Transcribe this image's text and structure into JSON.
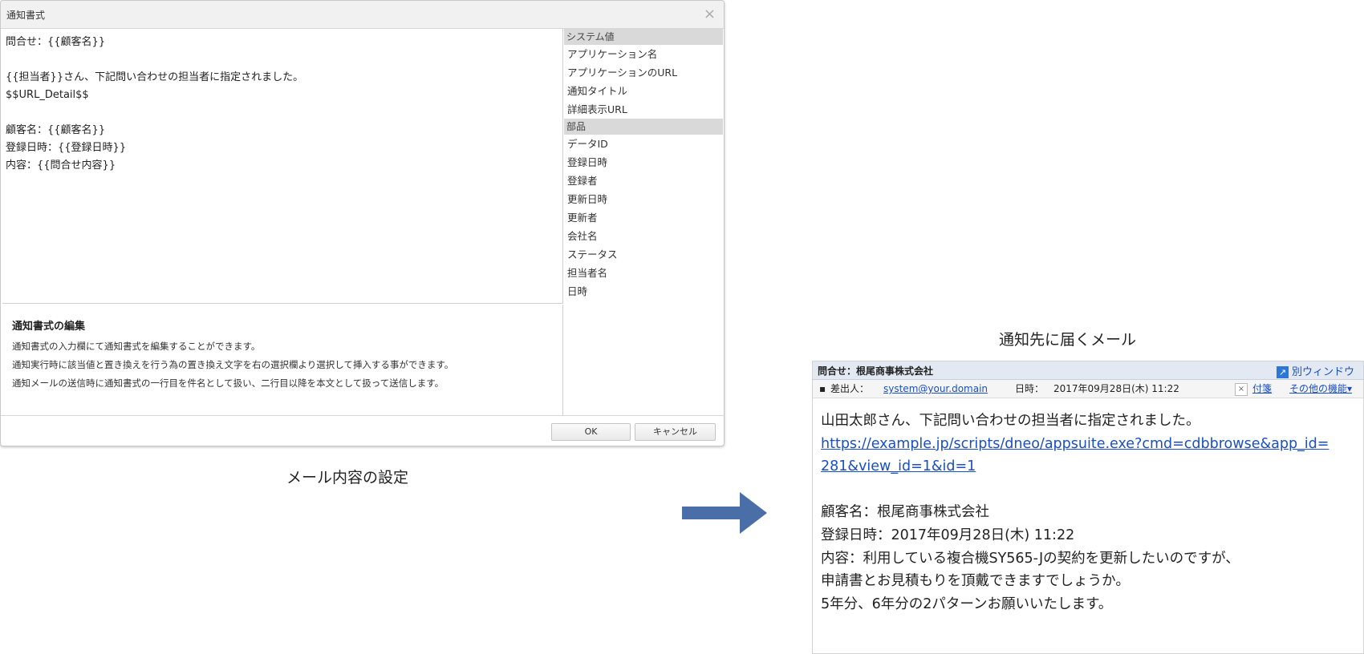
{
  "dialog": {
    "title": "通知書式",
    "close_glyph": "×",
    "editor_lines": [
      "問合せ：{{顧客名}}",
      "",
      "{{担当者}}さん、下記問い合わせの担当者に指定されました。",
      "$$URL_Detail$$",
      "",
      "顧客名：{{顧客名}}",
      "登録日時：{{登録日時}}",
      "内容：{{問合せ内容}}"
    ],
    "help": {
      "title": "通知書式の編集",
      "lines": [
        "通知書式の入力欄にて通知書式を編集することができます。",
        "通知実行時に該当値と置き換えを行う為の置き換え文字を右の選択欄より選択して挿入する事ができます。",
        "通知メールの送信時に通知書式の一行目を件名として扱い、二行目以降を本文として扱って送信します。"
      ]
    },
    "side": {
      "system_header": "システム値",
      "system_items": [
        "アプリケーション名",
        "アプリケーションのURL",
        "通知タイトル",
        "詳細表示URL"
      ],
      "parts_header": "部品",
      "parts_items": [
        "データID",
        "登録日時",
        "登録者",
        "更新日時",
        "更新者",
        "会社名",
        "ステータス",
        "担当者名",
        "日時"
      ]
    },
    "ok_label": "OK",
    "cancel_label": "キャンセル"
  },
  "captions": {
    "left": "メール内容の設定",
    "right": "通知先に届くメール"
  },
  "mail": {
    "subject": "問合せ：根尾商事株式会社",
    "new_window": "別ウィンドウ",
    "new_window_icon": "external-link-icon",
    "sender_label": "差出人：",
    "sender": "system@your.domain",
    "date_label": "日時：",
    "date": "2017年09月28日(木) 11:22",
    "x_glyph": "×",
    "attach": "付箋",
    "other_menu": "その他の機能▾",
    "body": {
      "l1": "山田太郎さん、下記問い合わせの担当者に指定されました。",
      "url1": "https://example.jp/scripts/dneo/appsuite.exe?cmd=cdbbrowse&app_id=",
      "url2": "281&view_id=1&id=1",
      "l4": "顧客名：根尾商事株式会社",
      "l5": "登録日時：2017年09月28日(木) 11:22",
      "l6": "内容：利用している複合機SY565-Jの契約を更新したいのですが、",
      "l7": "申請書とお見積もりを頂戴できますでしょうか。",
      "l8": "5年分、6年分の2パターンお願いいたします。"
    }
  },
  "colors": {
    "arrow": "#4a6fa8",
    "link": "#1a4fc4",
    "side_header": "#d9d9d9",
    "mail_subject_bg": "#e3e9f2"
  }
}
